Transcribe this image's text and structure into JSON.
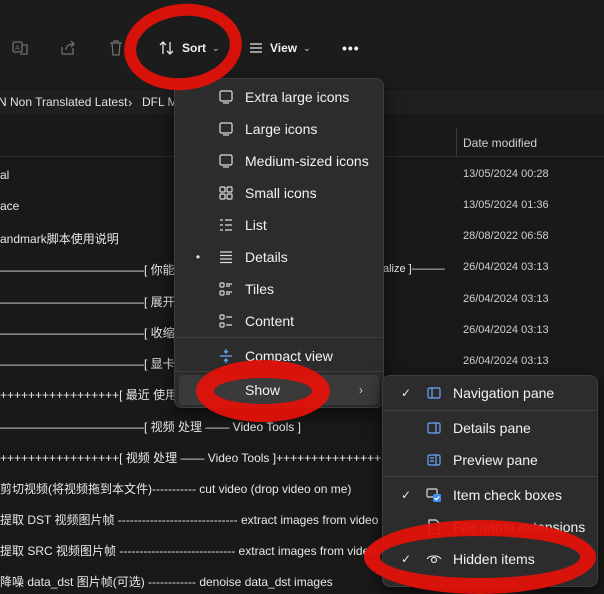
{
  "toolbar": {
    "sort_label": "Sort",
    "view_label": "View",
    "more_label": "•••",
    "icons": [
      "translate-icon",
      "share-icon",
      "delete-icon"
    ]
  },
  "breadcrumb": {
    "segment1": "N Non Translated Latest",
    "separator": "›",
    "segment2": "DFL M"
  },
  "columns": {
    "date_modified": "Date modified"
  },
  "rows": [
    {
      "name": "al",
      "date": "13/05/2024 00:28"
    },
    {
      "name": "ace",
      "date": "13/05/2024 01:36"
    },
    {
      "name": "andmark脚本使用说明",
      "date": "28/08/2022 06:58"
    },
    {
      "name": "————————————[ 你能看见我",
      "date": "26/04/2024 03:13"
    },
    {
      "name": "————————————[ 展开 全部 —",
      "date": "26/04/2024 03:13"
    },
    {
      "name": "————————————[ 收缩 全部 —",
      "date": "26/04/2024 03:13"
    },
    {
      "name": "————————————[ 显卡 设置 —",
      "date": "26/04/2024 03:13"
    },
    {
      "name": "+++++++++++++++++[ 最近 使用 —",
      "date": ""
    },
    {
      "name": "————————————[ 视频 处理 —— Video Tools ]",
      "date": ""
    },
    {
      "name": "+++++++++++++++++[ 视频 处理 —— Video Tools ]+++++++++++++++",
      "date": ""
    },
    {
      "name": "剪切视频(将视频拖到本文件)----------- cut video (drop video on me)",
      "date": ""
    },
    {
      "name": "提取 DST 视频图片帧 ------------------------------ extract images from video",
      "date": ""
    },
    {
      "name": "提取 SRC 视频图片帧 ----------------------------- extract images from video",
      "date": ""
    },
    {
      "name": "降噪 data_dst 图片帧(可选) ------------ denoise data_dst images",
      "date": ""
    }
  ],
  "row3_tail": "alize ]———",
  "view_menu": {
    "items": [
      {
        "label": "Extra large icons",
        "icon": "monitor-icon"
      },
      {
        "label": "Large icons",
        "icon": "monitor-icon"
      },
      {
        "label": "Medium-sized icons",
        "icon": "monitor-icon"
      },
      {
        "label": "Small icons",
        "icon": "grid-icon"
      },
      {
        "label": "List",
        "icon": "list-icon"
      },
      {
        "label": "Details",
        "icon": "details-icon",
        "selected": true
      },
      {
        "label": "Tiles",
        "icon": "tiles-icon"
      },
      {
        "label": "Content",
        "icon": "content-icon"
      },
      {
        "label": "Compact view",
        "icon": "compact-icon"
      },
      {
        "label": "Show",
        "icon": "",
        "submenu": true
      }
    ],
    "selected_bullet": "•",
    "submenu_arrow": "›"
  },
  "show_submenu": {
    "items": [
      {
        "label": "Navigation pane",
        "icon": "navigation-pane-icon",
        "checked": true
      },
      {
        "label": "Details pane",
        "icon": "details-pane-icon",
        "checked": false
      },
      {
        "label": "Preview pane",
        "icon": "preview-pane-icon",
        "checked": false
      },
      {
        "label": "Item check boxes",
        "icon": "checkbox-icon",
        "checked": true
      },
      {
        "label": "File name extensions",
        "icon": "file-extension-icon",
        "checked": false
      },
      {
        "label": "Hidden items",
        "icon": "eye-icon",
        "checked": true
      }
    ],
    "check_mark": "✓"
  },
  "colors": {
    "background": "#191919",
    "menu_bg": "#2c2c2c",
    "annotation_red": "#e0120b",
    "check_blue": "#3b8eea"
  }
}
